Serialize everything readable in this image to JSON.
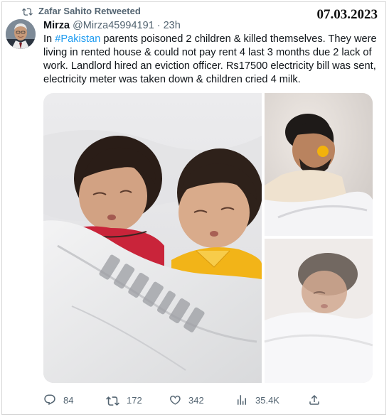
{
  "retweet_banner": {
    "text": "Zafar Sahito Retweeted"
  },
  "date_stamp": "07.03.2023",
  "tweet": {
    "author_name": "Mirza",
    "author_handle": "@Mirza45994191",
    "separator": "·",
    "time": "23h",
    "text": {
      "prefix": "In ",
      "hashtag": "#Pakistan",
      "body": " parents poisoned 2 children & killed themselves. They were living in rented house & could not pay rent 4 last 3 months due 2 lack of work. Landlord hired an eviction officer. Rs17500 electricity bill was sent, electricity meter was taken down & children cried 4 milk."
    }
  },
  "media": {
    "items": [
      {
        "name": "photo-children",
        "description_icon": "image"
      },
      {
        "name": "photo-father",
        "description_icon": "image"
      },
      {
        "name": "photo-mother",
        "description_icon": "image"
      }
    ]
  },
  "actions": {
    "replies": "84",
    "retweets": "172",
    "likes": "342",
    "views": "35.4K"
  },
  "icons": {
    "retweet": "retweet-icon",
    "reply": "reply-icon",
    "like": "heart-icon",
    "views": "views-icon",
    "share": "share-icon"
  },
  "colors": {
    "accent": "#1d9bf0",
    "secondary_text": "#536471"
  }
}
